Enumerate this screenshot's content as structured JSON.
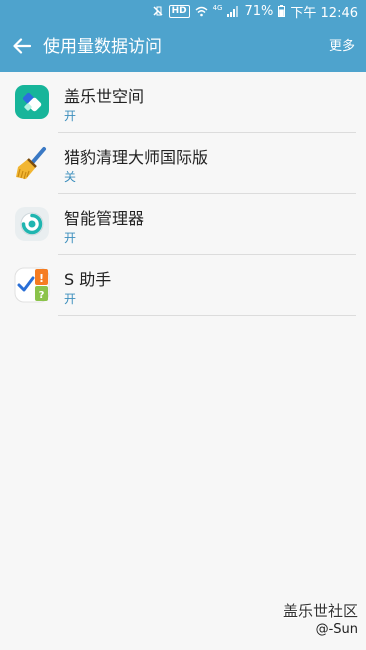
{
  "status_bar": {
    "battery": "71%",
    "time": "下午 12:46",
    "hd_label": "HD",
    "network_label": "4G"
  },
  "header": {
    "title": "使用量数据访问",
    "more_label": "更多"
  },
  "apps": [
    {
      "name": "盖乐世空间",
      "status": "开",
      "icon": "galaxy-space-icon"
    },
    {
      "name": "猎豹清理大师国际版",
      "status": "关",
      "icon": "clean-master-broom-icon"
    },
    {
      "name": "智能管理器",
      "status": "开",
      "icon": "smart-manager-icon"
    },
    {
      "name": "S 助手",
      "status": "开",
      "icon": "s-assistant-icon"
    }
  ],
  "watermark": {
    "title": "盖乐世社区",
    "author": "@-Sun"
  },
  "colors": {
    "accent": "#4ea3cd",
    "status_text": "#3d8fbd"
  }
}
